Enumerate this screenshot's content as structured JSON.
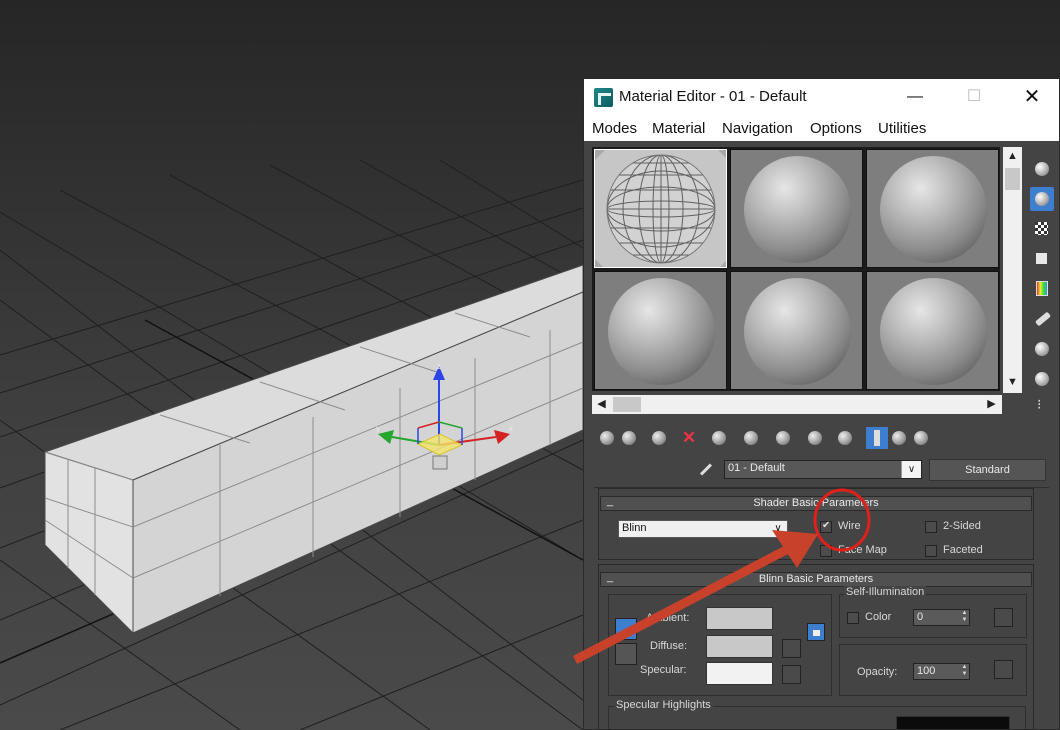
{
  "window": {
    "title": "Material Editor - 01 - Default",
    "minimize": "—",
    "maximize": "☐",
    "close": "✕"
  },
  "menu": [
    {
      "label": "Modes"
    },
    {
      "label": "Material"
    },
    {
      "label": "Navigation"
    },
    {
      "label": "Options"
    },
    {
      "label": "Utilities"
    }
  ],
  "material": {
    "name": "01 - Default",
    "type_button": "Standard"
  },
  "shader_basic": {
    "title": "Shader Basic Parameters",
    "toggle": "_",
    "shader": "Blinn",
    "wire": {
      "label": "Wire",
      "checked": true
    },
    "two_sided": {
      "label": "2-Sided",
      "checked": false
    },
    "face_map": {
      "label": "Face Map",
      "checked": false
    },
    "faceted": {
      "label": "Faceted",
      "checked": false
    }
  },
  "blinn_basic": {
    "title": "Blinn Basic Parameters",
    "toggle": "_",
    "ambient_label": "Ambient:",
    "diffuse_label": "Diffuse:",
    "specular_label": "Specular:",
    "ambient_color": "#c8c8c8",
    "diffuse_color": "#c8c8c8",
    "specular_color": "#f2f2f2",
    "self_illum": {
      "title": "Self-Illumination",
      "color_label": "Color",
      "color_checked": false,
      "value": "0"
    },
    "opacity_label": "Opacity:",
    "opacity_value": "100"
  },
  "specular_highlights": {
    "title": "Specular Highlights"
  },
  "viewport": {
    "axis_x": "x",
    "axis_y": "y",
    "axis_z": "z"
  },
  "colors": {
    "accent": "#3d7ecf",
    "annotation": "#c8412b",
    "annotation_circle": "#e0201a"
  }
}
